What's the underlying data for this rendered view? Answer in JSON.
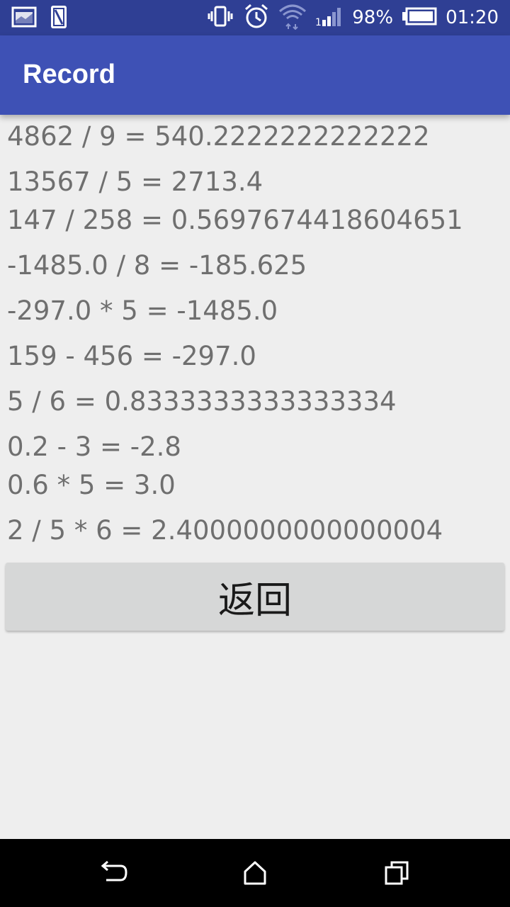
{
  "status_bar": {
    "battery_percent": "98%",
    "time": "01:20",
    "icons": [
      "gallery-icon",
      "sim-card-icon",
      "vibrate-icon",
      "alarm-icon",
      "wifi-icon",
      "signal-icon",
      "battery-icon"
    ]
  },
  "app_bar": {
    "title": "Record"
  },
  "records": [
    "4862 / 9 = 540.2222222222222",
    "13567 / 5 = 2713.4",
    "147 / 258 = 0.5697674418604651",
    "-1485.0 / 8 = -185.625",
    "-297.0 * 5 = -1485.0",
    "159 - 456 = -297.0",
    "5 / 6 = 0.8333333333333334",
    "0.2 - 3 = -2.8",
    "0.6 * 5 = 3.0",
    "2 / 5 * 6 = 2.4000000000000004"
  ],
  "back_button": {
    "label": "返回"
  },
  "nav_bar": {
    "icons": [
      "back-icon",
      "home-icon",
      "recents-icon"
    ]
  },
  "colors": {
    "status_bar": "#2f3f94",
    "app_bar": "#3e51b5",
    "background": "#eeeeee",
    "record_text": "#6f6f6f",
    "button": "#d6d7d7"
  }
}
